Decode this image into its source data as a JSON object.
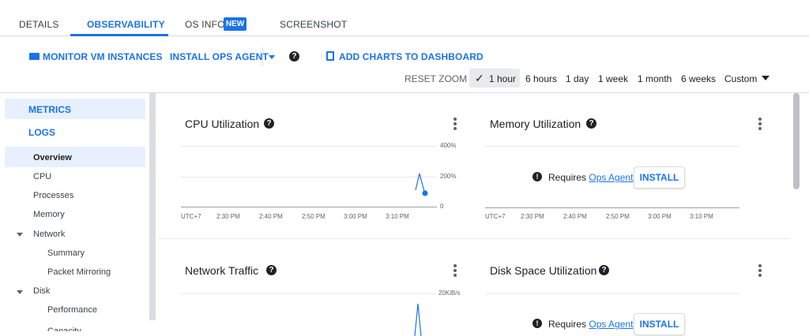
{
  "tabs": [
    "DETAILS",
    "OBSERVABILITY",
    "OS INFO",
    "SCREENSHOT"
  ],
  "new_badge": "NEW",
  "toolbar": {
    "monitor": "MONITOR VM INSTANCES",
    "install_ops": "INSTALL OPS AGENT",
    "add_charts": "ADD CHARTS TO DASHBOARD"
  },
  "timerange": {
    "reset_zoom": "RESET ZOOM",
    "options": [
      "1 hour",
      "6 hours",
      "1 day",
      "1 week",
      "1 month",
      "6 weeks",
      "Custom"
    ],
    "selected": "1 hour"
  },
  "sidebar": {
    "sections": [
      "METRICS",
      "LOGS"
    ],
    "items": [
      "Overview",
      "CPU",
      "Processes",
      "Memory",
      "Network",
      "Summary",
      "Packet Mirroring",
      "Disk",
      "Performance",
      "Capacity"
    ]
  },
  "cards": {
    "cpu": {
      "title": "CPU Utilization",
      "y_ticks": [
        "400%",
        "200%",
        "0"
      ]
    },
    "memory": {
      "title": "Memory Utilization"
    },
    "network": {
      "title": "Network Traffic",
      "y_ticks": [
        "20KiB/s"
      ]
    },
    "disk": {
      "title": "Disk Space Utilization"
    }
  },
  "x_axis": [
    "UTC+7",
    "2:30 PM",
    "2:40 PM",
    "2:50 PM",
    "3:00 PM",
    "3:10 PM"
  ],
  "requires": {
    "text": "Requires",
    "link": "Ops Agent",
    "button": "INSTALL"
  },
  "colors": {
    "accent": "#1a73e8",
    "series": "#1a73e8"
  }
}
